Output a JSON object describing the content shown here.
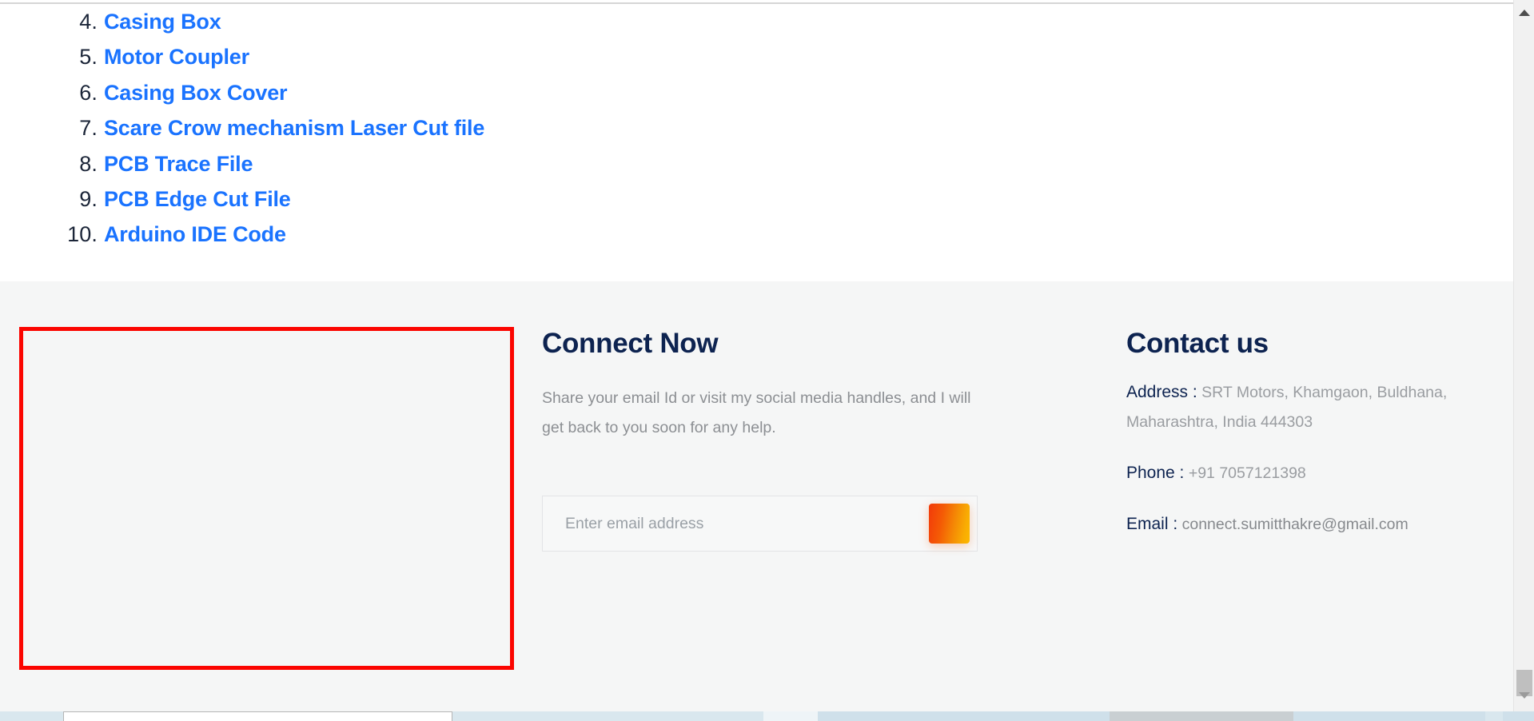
{
  "page": {
    "file_list": [
      {
        "number": "4.",
        "label": "Casing Box"
      },
      {
        "number": "5.",
        "label": "Motor Coupler"
      },
      {
        "number": "6.",
        "label": "Casing Box Cover"
      },
      {
        "number": "7.",
        "label": "Scare Crow mechanism Laser Cut file"
      },
      {
        "number": "8.",
        "label": "PCB Trace File"
      },
      {
        "number": "9.",
        "label": "PCB Edge Cut File"
      },
      {
        "number": "10.",
        "label": "Arduino IDE Code"
      }
    ]
  },
  "footer": {
    "connect": {
      "title": "Connect Now",
      "blurb": "Share your email Id or visit my social media handles, and I will get back to you soon for any help.",
      "email_placeholder": "Enter email address",
      "email_value": "",
      "submit_label": ""
    },
    "contact": {
      "title": "Contact us",
      "address_label": "Address :",
      "address_value": "SRT Motors, Khamgaon, Buldhana, Maharashtra, India 444303",
      "phone_label": "Phone :",
      "phone_value": "+91 7057121398",
      "email_label": "Email :",
      "email_value": "connect.sumitthakre@gmail.com"
    }
  },
  "colors": {
    "link_blue": "#1a73ff",
    "heading_navy": "#0d2350",
    "body_gray": "#8c8f93",
    "footer_bg": "#f5f6f6",
    "highlight_red": "#fb0500",
    "button_gradient_start": "#f23a0a",
    "button_gradient_end": "#fcb900"
  }
}
